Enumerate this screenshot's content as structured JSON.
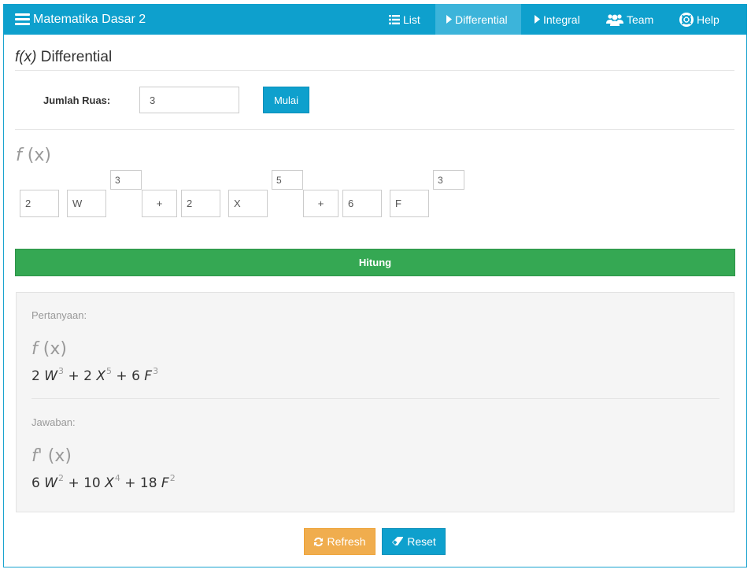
{
  "app": {
    "title": "Matematika Dasar 2"
  },
  "nav": {
    "items": [
      {
        "label": "List",
        "icon": "list-icon"
      },
      {
        "label": "Differential",
        "icon": "play-icon",
        "active": true
      },
      {
        "label": "Integral",
        "icon": "play-icon"
      },
      {
        "label": "Team",
        "icon": "users-icon"
      },
      {
        "label": "Help",
        "icon": "lifebuoy-icon"
      }
    ]
  },
  "page": {
    "title_fx": "f(x)",
    "title_text": "Differential"
  },
  "form": {
    "ruas_label": "Jumlah Ruas:",
    "ruas_value": "3",
    "mulai_label": "Mulai"
  },
  "equation": {
    "heading_f": "f",
    "heading_x": "(x)",
    "terms": [
      {
        "coef": "2",
        "var": "W",
        "exp": "3"
      },
      {
        "coef": "2",
        "var": "X",
        "exp": "5"
      },
      {
        "coef": "6",
        "var": "F",
        "exp": "3"
      }
    ],
    "operators": [
      "+",
      "+"
    ]
  },
  "hitung_label": "Hitung",
  "result": {
    "question_label": "Pertanyaan:",
    "question_f": "f",
    "question_x": "(x)",
    "question_terms": [
      {
        "coef": "2",
        "var": "W",
        "exp": "3",
        "op": "+"
      },
      {
        "coef": "2",
        "var": "X",
        "exp": "5",
        "op": "+"
      },
      {
        "coef": "6",
        "var": "F",
        "exp": "3",
        "op": ""
      }
    ],
    "answer_label": "Jawaban:",
    "answer_f": "f'",
    "answer_x": "(x)",
    "answer_terms": [
      {
        "coef": "6",
        "var": "W",
        "exp": "2",
        "op": "+"
      },
      {
        "coef": "10",
        "var": "X",
        "exp": "4",
        "op": "+"
      },
      {
        "coef": "18",
        "var": "F",
        "exp": "2",
        "op": ""
      }
    ]
  },
  "buttons": {
    "refresh_label": "Refresh",
    "reset_label": "Reset"
  },
  "colors": {
    "primary": "#0ea0cd",
    "success": "#35a853",
    "warning": "#f0ad4e"
  }
}
